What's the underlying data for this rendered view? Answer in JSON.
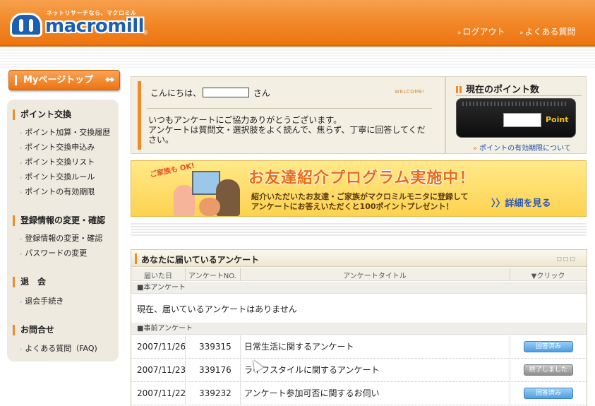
{
  "header": {
    "logo_tagline": "ネットリサーチなら、マクロミル",
    "logo_text": "macromill",
    "logo_mark": "®",
    "logout": "ログアウト",
    "faq": "よくある質問"
  },
  "sidebar": {
    "mypage_top": "Myページトップ",
    "sections": [
      {
        "title": "ポイント交換",
        "links": [
          "ポイント加算・交換履歴",
          "ポイント交換申込み",
          "ポイント交換リスト",
          "ポイント交換ルール",
          "ポイントの有効期限"
        ]
      },
      {
        "title": "登録情報の変更・確認",
        "links": [
          "登録情報の変更・確認",
          "パスワードの変更"
        ]
      },
      {
        "title": "退　会",
        "links": [
          "退会手続き"
        ]
      },
      {
        "title": "お問合せ",
        "links": [
          "よくある質問（FAQ)"
        ]
      }
    ]
  },
  "welcome": {
    "greeting_prefix": "こんにちは、",
    "greeting_suffix": "さん",
    "tag": "WELCOME!",
    "message_line1": "いつもアンケートにご協力ありがとうございます。",
    "message_line2": "アンケートは質問文・選択肢をよく読んで、焦らず、丁寧に回答してください。"
  },
  "points": {
    "title": "現在のポイント数",
    "unit": "Point",
    "expiry_link": "ポイントの有効期限について"
  },
  "banner": {
    "badge": "ご家族も OK!",
    "headline": "お友達紹介プログラム実施中！",
    "sub_line1": "紹介いただいたお友達・ご家族がマクロミルモニタに登録して",
    "sub_line2": "アンケートにお答えいただくと100ポイントプレゼント！",
    "more": "〉〉詳細を見る"
  },
  "survey": {
    "title": "あなたに届いているアンケート",
    "columns": [
      "届いた日",
      "アンケートNO.",
      "アンケートタイトル",
      "▼クリック"
    ],
    "main_label": "■本アンケート",
    "empty_message": "現在、届いているアンケートはありません",
    "pre_label": "■事前アンケート",
    "rows": [
      {
        "date": "2007/11/26",
        "no": "339315",
        "title": "日常生活に関するアンケート",
        "status": "回答済み"
      },
      {
        "date": "2007/11/23",
        "no": "339176",
        "title": "ライフスタイルに関するアンケート",
        "status": "終了しました"
      },
      {
        "date": "2007/11/22",
        "no": "339232",
        "title": "アンケート参加可否に関するお伺い",
        "status": "回答済み"
      }
    ]
  },
  "colors": {
    "brand_orange": "#ec7410",
    "brand_blue": "#1c5fb0",
    "status_blue": "#4f9ee3",
    "status_gray": "#8e8e8e"
  }
}
